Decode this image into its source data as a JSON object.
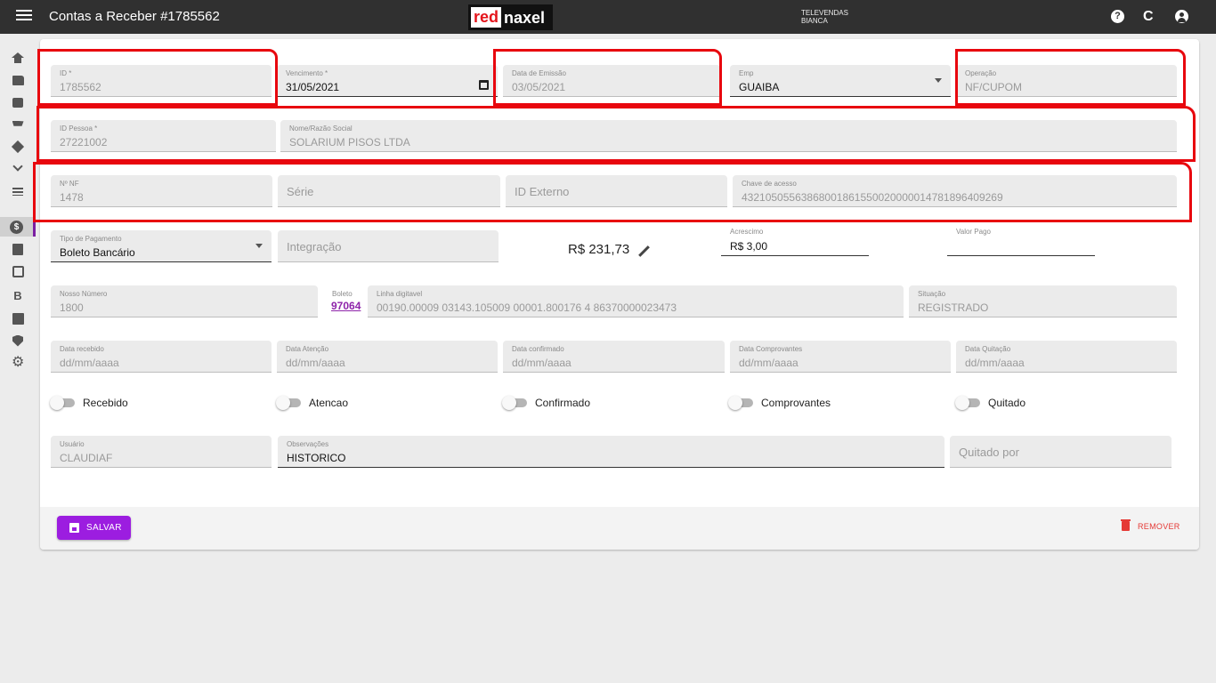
{
  "header": {
    "title": "Contas a Receber #1785562",
    "logo_red": "red",
    "logo_naxel": "naxel",
    "user_company": "TELEVENDAS",
    "user_name": "BIANCA",
    "help_symbol": "?",
    "refresh_symbol": "C",
    "icons": [
      "menu-icon",
      "help-icon",
      "refresh-icon",
      "account-icon"
    ]
  },
  "sidebar": {
    "items": [
      {
        "icon": "home-icon"
      },
      {
        "icon": "folder-icon"
      },
      {
        "icon": "briefcase-icon"
      },
      {
        "icon": "cart-icon"
      },
      {
        "icon": "diamond-icon"
      },
      {
        "icon": "chevron-down-icon"
      },
      {
        "icon": "list-icon"
      },
      {
        "icon": "dollar-icon",
        "active": true,
        "symbol": "$"
      },
      {
        "icon": "contact-icon"
      },
      {
        "icon": "frame-icon"
      },
      {
        "icon": "b-icon",
        "symbol": "B"
      },
      {
        "icon": "image-icon"
      },
      {
        "icon": "shield-icon"
      },
      {
        "icon": "gear-icon",
        "symbol": "⚙"
      }
    ],
    "accent_color": "#7b1fa2"
  },
  "form": {
    "id": {
      "label": "ID *",
      "value": "1785562"
    },
    "vencimento": {
      "label": "Vencimento *",
      "value": "31/05/2021"
    },
    "data_emissao": {
      "label": "Data de Emissão",
      "value": "03/05/2021"
    },
    "emp": {
      "label": "Emp",
      "value": "GUAIBA"
    },
    "operacao": {
      "label": "Operação",
      "value": "NF/CUPOM"
    },
    "id_pessoa": {
      "label": "ID Pessoa *",
      "value": "27221002"
    },
    "nome": {
      "label": "Nome/Razão Social",
      "value": "SOLARIUM PISOS LTDA"
    },
    "nf": {
      "label": "Nº NF",
      "value": "1478"
    },
    "serie": {
      "placeholder": "Série"
    },
    "id_externo": {
      "placeholder": "ID Externo"
    },
    "chave": {
      "label": "Chave de acesso",
      "value": "43210505563868001861550020000014781896409269"
    },
    "tipo_pagamento": {
      "label": "Tipo de Pagamento",
      "value": "Boleto Bancário"
    },
    "integracao": {
      "placeholder": "Integração"
    },
    "total": "R$ 231,73",
    "acrescimo": {
      "label": "Acrescimo",
      "value": "R$ 3,00"
    },
    "valor_pago": {
      "label": "Valor Pago",
      "value": ""
    },
    "nosso_numero": {
      "label": "Nosso Número",
      "value": "1800"
    },
    "boleto": {
      "label": "Boleto",
      "link": "97064"
    },
    "linha_digitavel": {
      "label": "Linha digitavel",
      "value": "00190.00009 03143.105009 00001.800176 4 86370000023473"
    },
    "situacao": {
      "label": "Situação",
      "value": "REGISTRADO"
    },
    "data_recebido": {
      "label": "Data recebido",
      "value": "dd/mm/aaaa"
    },
    "data_atencao": {
      "label": "Data Atenção",
      "value": "dd/mm/aaaa"
    },
    "data_confirmado": {
      "label": "Data confirmado",
      "value": "dd/mm/aaaa"
    },
    "data_comprovantes": {
      "label": "Data Comprovantes",
      "value": "dd/mm/aaaa"
    },
    "data_quitacao": {
      "label": "Data Quitação",
      "value": "dd/mm/aaaa"
    },
    "toggles": [
      {
        "label": "Recebido",
        "checked": false
      },
      {
        "label": "Atencao",
        "checked": false
      },
      {
        "label": "Confirmado",
        "checked": false
      },
      {
        "label": "Comprovantes",
        "checked": false
      },
      {
        "label": "Quitado",
        "checked": false
      }
    ],
    "usuario": {
      "label": "Usuário",
      "value": "CLAUDIAF"
    },
    "observacoes": {
      "label": "Observações",
      "value": "HISTORICO"
    },
    "quitado_por": {
      "placeholder": "Quitado por"
    }
  },
  "footer": {
    "save_label": "SALVAR",
    "remove_label": "REMOVER",
    "save_color": "#9c1de0",
    "remove_color": "#e53935"
  },
  "highlight_color": "#e8070e"
}
